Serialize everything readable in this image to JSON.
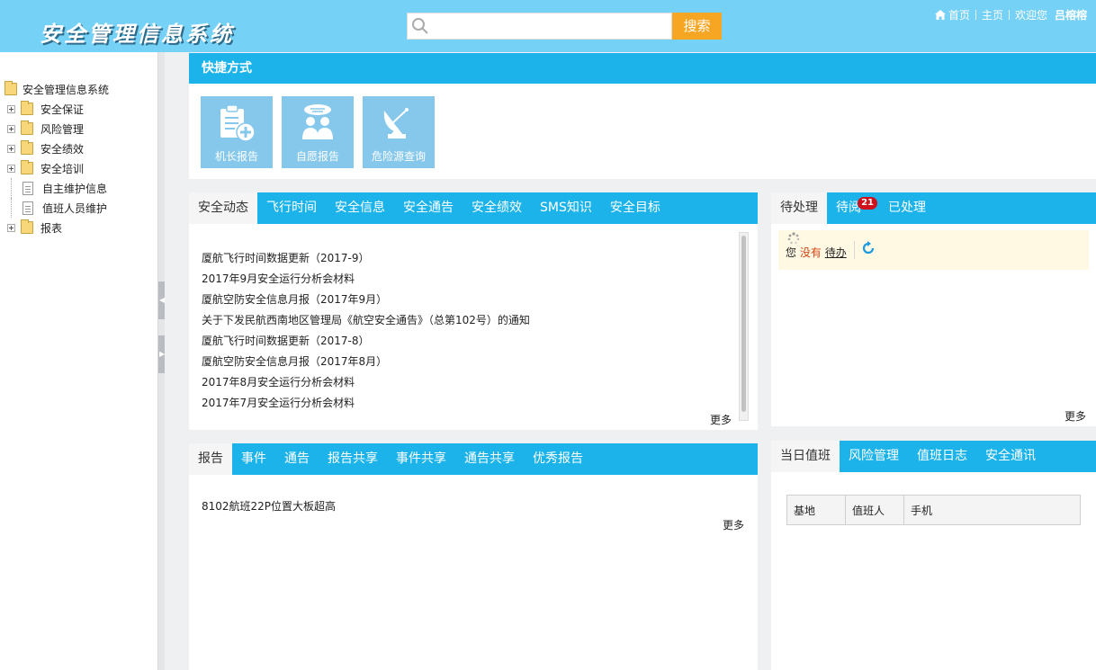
{
  "header": {
    "logo": "安全管理信息系统",
    "search_placeholder": "",
    "search_button": "搜索",
    "nav": {
      "home": "首页",
      "main": "主页",
      "welcome": "欢迎您",
      "user": "吕榕榕"
    }
  },
  "sidebar": {
    "root": "安全管理信息系统",
    "items": [
      {
        "label": "安全保证",
        "type": "folder"
      },
      {
        "label": "风险管理",
        "type": "folder"
      },
      {
        "label": "安全绩效",
        "type": "folder"
      },
      {
        "label": "安全培训",
        "type": "folder"
      },
      {
        "label": "自主维护信息",
        "type": "doc"
      },
      {
        "label": "值班人员维护",
        "type": "doc"
      },
      {
        "label": "报表",
        "type": "folder"
      }
    ]
  },
  "shortcuts": {
    "title": "快捷方式",
    "items": [
      {
        "label": "机长报告",
        "icon": "clipboard-plus-icon"
      },
      {
        "label": "自愿报告",
        "icon": "people-chat-icon"
      },
      {
        "label": "危险源查询",
        "icon": "satellite-dish-icon"
      }
    ]
  },
  "news": {
    "tabs": [
      "安全动态",
      "飞行时间",
      "安全信息",
      "安全通告",
      "安全绩效",
      "SMS知识",
      "安全目标"
    ],
    "items": [
      "厦航飞行时间数据更新（2017-9）",
      "2017年9月安全运行分析会材料",
      "厦航空防安全信息月报（2017年9月）",
      "关于下发民航西南地区管理局《航空安全通告》（总第102号）的通知",
      "厦航飞行时间数据更新（2017-8）",
      "厦航空防安全信息月报（2017年8月）",
      "2017年8月安全运行分析会材料",
      "2017年7月安全运行分析会材料"
    ],
    "more": "更多"
  },
  "todo": {
    "tabs": [
      "待处理",
      "待阅",
      "已处理"
    ],
    "badge": "21",
    "you": "您",
    "none": "没有",
    "pending": "待办",
    "more": "更多"
  },
  "reports": {
    "tabs": [
      "报告",
      "事件",
      "通告",
      "报告共享",
      "事件共享",
      "通告共享",
      "优秀报告"
    ],
    "items": [
      "8102航班22P位置大板超高"
    ],
    "more": "更多"
  },
  "duty": {
    "tabs": [
      "当日值班",
      "风险管理",
      "值班日志",
      "安全通讯"
    ],
    "columns": [
      "基地",
      "值班人",
      "手机"
    ]
  }
}
